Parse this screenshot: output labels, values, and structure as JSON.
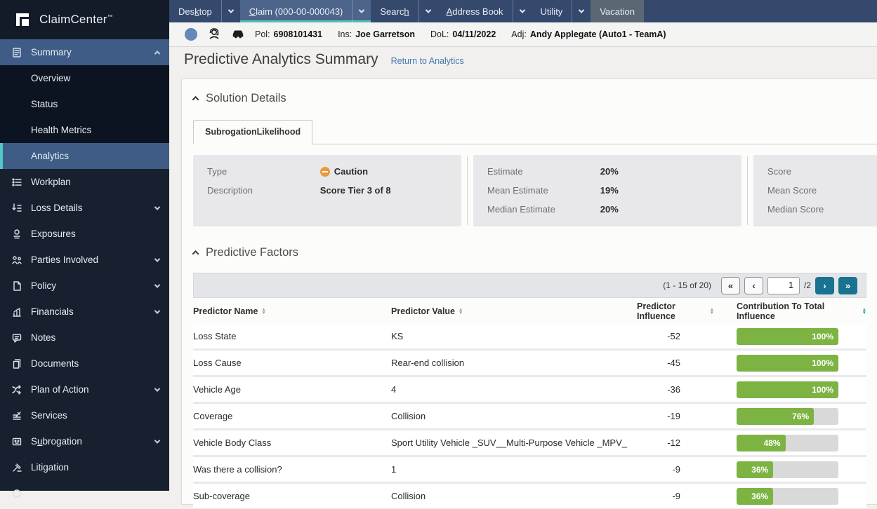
{
  "app": {
    "logo": "ClaimCenter",
    "logo_tm": "™"
  },
  "top_nav": {
    "tabs": [
      {
        "pre": "Des",
        "key": "k",
        "post": "top"
      },
      {
        "pre": "",
        "key": "C",
        "post": "laim (000-00-000043)"
      },
      {
        "pre": "Searc",
        "key": "h",
        "post": ""
      },
      {
        "pre": "",
        "key": "A",
        "post": "ddress Book"
      },
      {
        "pre": "Utility",
        "key": "",
        "post": ""
      },
      {
        "pre": "Vacation",
        "key": "",
        "post": ""
      }
    ]
  },
  "claim_bar": {
    "fields": [
      {
        "label": "Pol:",
        "value": "6908101431"
      },
      {
        "label": "Ins:",
        "value": "Joe Garretson"
      },
      {
        "label": "DoL:",
        "value": "04/11/2022"
      },
      {
        "label": "Adj:",
        "value": "Andy Applegate (Auto1 - TeamA)"
      }
    ]
  },
  "sidebar": {
    "items": [
      {
        "label": "Summary"
      },
      {
        "label": "Workplan"
      },
      {
        "label": "Loss Details"
      },
      {
        "label": "Exposures"
      },
      {
        "label": "Parties Involved"
      },
      {
        "label": "Policy"
      },
      {
        "label": "Financials"
      },
      {
        "label": "Notes"
      },
      {
        "label": "Documents"
      },
      {
        "label": "Plan of Action"
      },
      {
        "label": "Services"
      },
      {
        "pre": "S",
        "key": "u",
        "post": "brogation"
      },
      {
        "label": "Litigation"
      }
    ],
    "summary_children": [
      {
        "label": "Overview"
      },
      {
        "label": "Status"
      },
      {
        "label": "Health Metrics"
      },
      {
        "label": "Analytics"
      }
    ]
  },
  "page": {
    "title": "Predictive Analytics Summary",
    "back_link": "Return to Analytics"
  },
  "solution_details": {
    "heading": "Solution Details",
    "tab": "SubrogationLikelihood",
    "card_type": {
      "rows": [
        {
          "label": "Type",
          "value": "Caution"
        },
        {
          "label": "Description",
          "value": "Score Tier 3 of 8"
        }
      ]
    },
    "card_estimate": {
      "rows": [
        {
          "label": "Estimate",
          "value": "20%"
        },
        {
          "label": "Mean Estimate",
          "value": "19%"
        },
        {
          "label": "Median Estimate",
          "value": "20%"
        }
      ]
    },
    "card_score": {
      "rows": [
        {
          "label": "Score",
          "value": ""
        },
        {
          "label": "Mean Score",
          "value": ""
        },
        {
          "label": "Median Score",
          "value": ""
        }
      ]
    }
  },
  "predictive_factors": {
    "heading": "Predictive Factors",
    "pagination": {
      "summary": "(1 - 15 of 20)",
      "first": "«",
      "prev": "‹",
      "next": "›",
      "last": "»",
      "page": "1",
      "total": "/2"
    },
    "columns": [
      "Predictor Name",
      "Predictor Value",
      "Predictor Influence",
      "Contribution To Total Influence"
    ],
    "rows": [
      {
        "name": "Loss State",
        "value": "KS",
        "influence": "-52",
        "bar": 100,
        "bar_label": "100%"
      },
      {
        "name": "Loss Cause",
        "value": "Rear-end collision",
        "influence": "-45",
        "bar": 100,
        "bar_label": "100%"
      },
      {
        "name": "Vehicle Age",
        "value": "4",
        "influence": "-36",
        "bar": 100,
        "bar_label": "100%"
      },
      {
        "name": "Coverage",
        "value": "Collision",
        "influence": "-19",
        "bar": 76,
        "bar_label": "76%"
      },
      {
        "name": "Vehicle Body Class",
        "value": "Sport Utility Vehicle _SUV__Multi-Purpose Vehicle _MPV_",
        "influence": "-12",
        "bar": 48,
        "bar_label": "48%"
      },
      {
        "name": "Was there a collision?",
        "value": "1",
        "influence": "-9",
        "bar": 36,
        "bar_label": "36%"
      },
      {
        "name": "Sub-coverage",
        "value": "Collision",
        "influence": "-9",
        "bar": 36,
        "bar_label": "36%"
      }
    ]
  },
  "colors": {
    "bar_green": "#7cb342",
    "accent_teal": "#4fc9c4",
    "pagination_active": "#1a7291",
    "caution_orange": "#e99a3b"
  }
}
